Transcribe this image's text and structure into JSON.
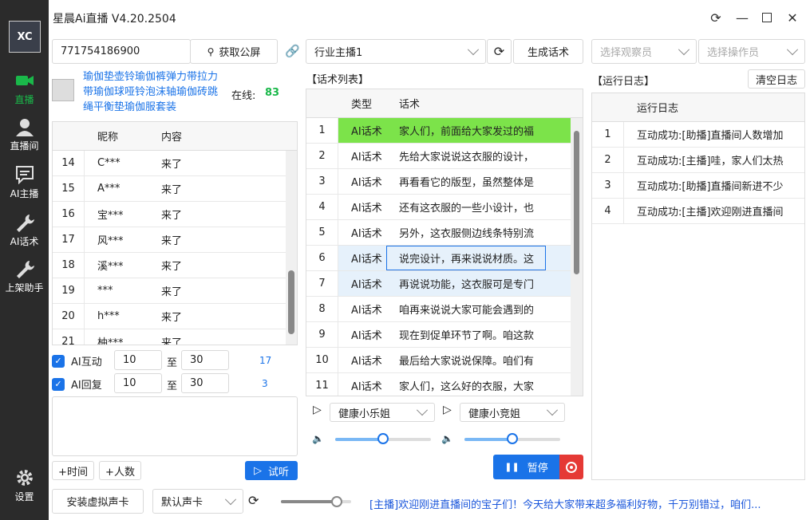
{
  "app": {
    "title": "星晨Ai直播 V4.20.2504",
    "logo": "XC"
  },
  "sidebar": {
    "items": [
      {
        "label": "直播"
      },
      {
        "label": "直播间"
      },
      {
        "label": "AI主播"
      },
      {
        "label": "AI话术"
      },
      {
        "label": "上架助手"
      }
    ],
    "settings": "设置"
  },
  "top": {
    "room_id": "771754186900",
    "get_screen": "获取公屏",
    "industry": "行业主播1",
    "generate": "生成话术",
    "observer_ph": "选择观察员",
    "operator_ph": "选择操作员"
  },
  "product": {
    "title": "瑜伽垫壶铃瑜伽裤弹力带拉力带瑜伽球哑铃泡沫轴瑜伽砖跳绳平衡垫瑜伽服套装",
    "online_label": "在线:",
    "online": "83"
  },
  "comments": {
    "headers": [
      "昵称",
      "内容"
    ],
    "rows": [
      [
        "14",
        "C***",
        "来了"
      ],
      [
        "15",
        "A***",
        "来了"
      ],
      [
        "16",
        "宝***",
        "来了"
      ],
      [
        "17",
        "风***",
        "来了"
      ],
      [
        "18",
        "溪***",
        "来了"
      ],
      [
        "19",
        "***",
        "来了"
      ],
      [
        "20",
        "h***",
        "来了"
      ],
      [
        "21",
        "柚***",
        "来了"
      ]
    ]
  },
  "ai": {
    "interact_label": "AI互动",
    "interact_from": "10",
    "to": "至",
    "interact_to": "30",
    "interact_count": "17",
    "reply_label": "AI回复",
    "reply_from": "10",
    "reply_to": "30",
    "reply_count": "3"
  },
  "buttons": {
    "add_time": "+时间",
    "add_people": "+人数",
    "listen": "试听",
    "install_card": "安装虚拟声卡",
    "default_card": "默认声卡",
    "pause": "暂停",
    "clear_log": "清空日志"
  },
  "scripts": {
    "section": "【话术列表】",
    "headers": [
      "类型",
      "话术"
    ],
    "rows": [
      [
        "1",
        "AI话术",
        "家人们，前面给大家发过的福"
      ],
      [
        "2",
        "AI话术",
        "先给大家说说这衣服的设计，"
      ],
      [
        "3",
        "AI话术",
        "再看看它的版型，虽然整体是"
      ],
      [
        "4",
        "AI话术",
        "还有这衣服的一些小设计，也"
      ],
      [
        "5",
        "AI话术",
        "另外，这衣服侧边线条特别流"
      ],
      [
        "6",
        "AI话术",
        "说完设计，再来说说材质。这"
      ],
      [
        "7",
        "AI话术",
        "再说说功能，这衣服可是专门"
      ],
      [
        "8",
        "AI话术",
        "咱再来说说大家可能会遇到的"
      ],
      [
        "9",
        "AI话术",
        "现在到促单环节了啊。咱这款"
      ],
      [
        "10",
        "AI话术",
        "最后给大家说说保障。咱们有"
      ],
      [
        "11",
        "AI话术",
        "家人们，这么好的衣服，大家"
      ]
    ]
  },
  "voices": {
    "a": "健康小乐姐",
    "b": "健康小竞姐",
    "vol_a": 0.5,
    "vol_b": 0.5,
    "main_vol": 0.8
  },
  "log": {
    "section": "【运行日志】",
    "header": "运行日志",
    "rows": [
      [
        "1",
        "互动成功:[助播]直播间人数增加"
      ],
      [
        "2",
        "互动成功:[主播]哇，家人们太热"
      ],
      [
        "3",
        "互动成功:[助播]直播间新进不少"
      ],
      [
        "4",
        "互动成功:[主播]欢迎刚进直播间"
      ]
    ]
  },
  "status": {
    "text": "[主播]欢迎刚进直播间的宝子们！今天给大家带来超多福利好物，千万别错过，咱们..."
  }
}
